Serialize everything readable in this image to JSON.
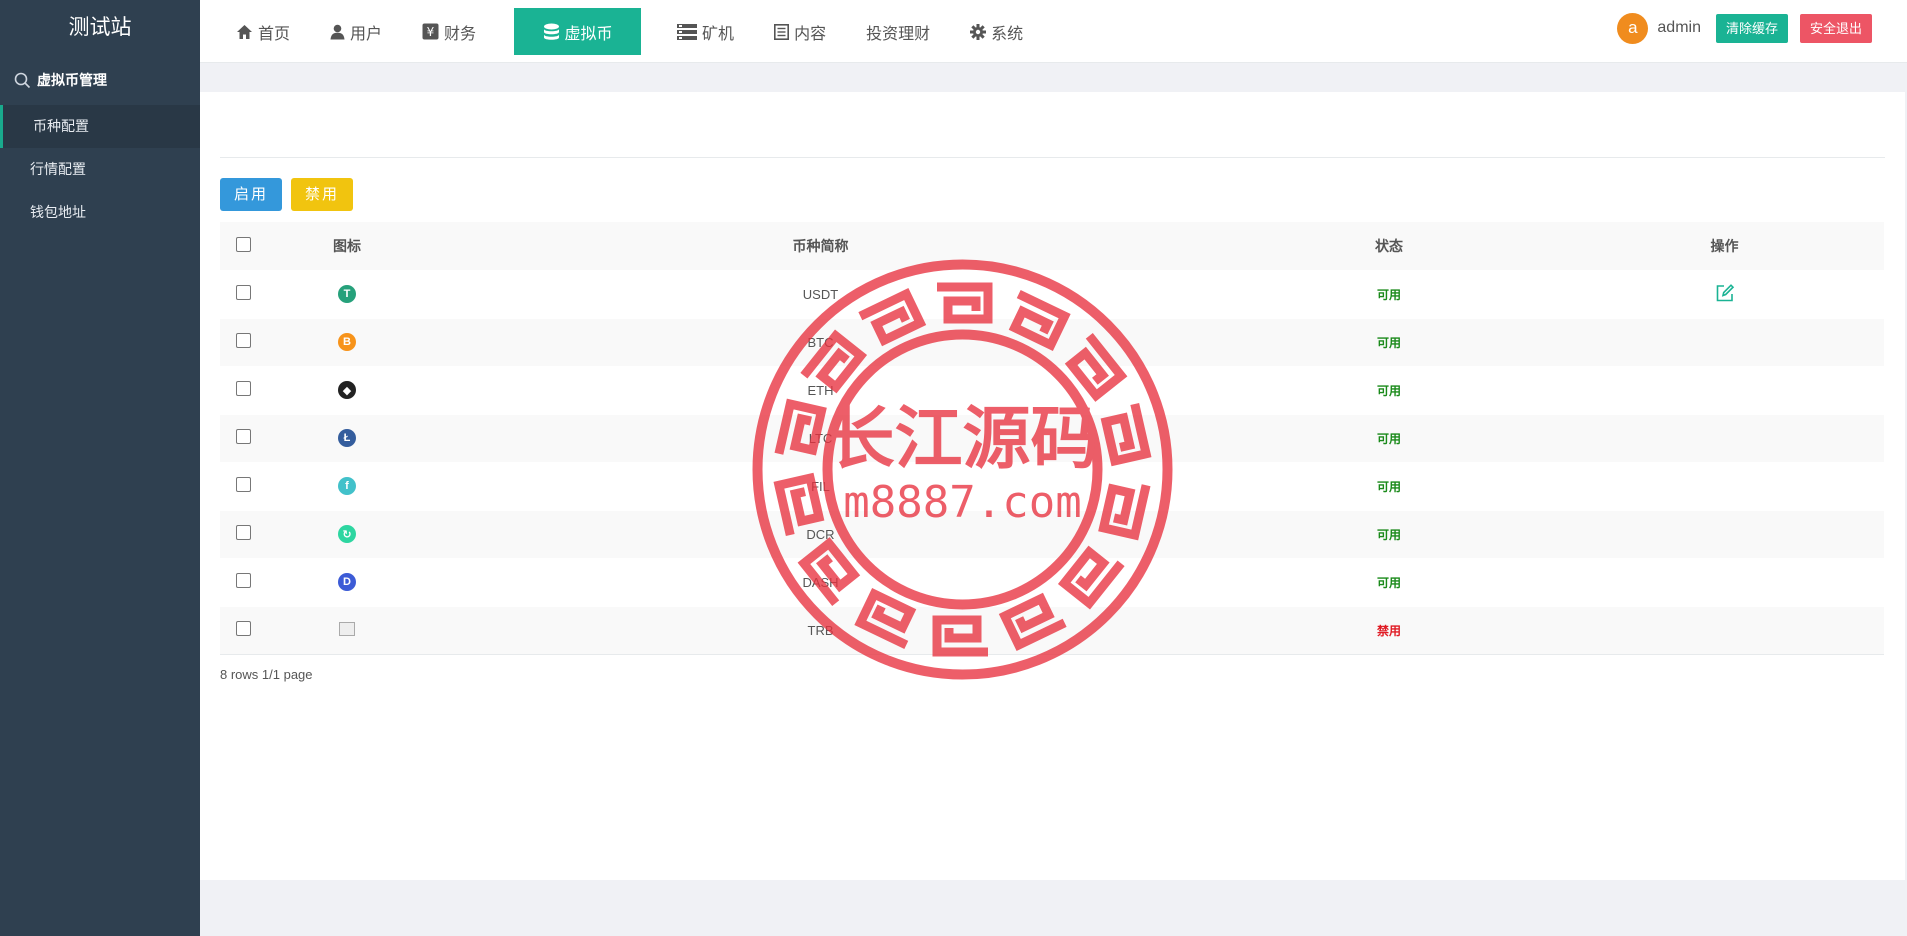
{
  "sidebar": {
    "site_title": "测试站",
    "section": "虚拟币管理",
    "items": [
      {
        "label": "币种配置",
        "active": true
      },
      {
        "label": "行情配置",
        "active": false
      },
      {
        "label": "钱包地址",
        "active": false
      }
    ]
  },
  "nav": {
    "items": [
      {
        "label": "首页",
        "icon": "home-icon"
      },
      {
        "label": "用户",
        "icon": "user-icon"
      },
      {
        "label": "财务",
        "icon": "yen-icon"
      },
      {
        "label": "虚拟币",
        "icon": "database-icon",
        "active": true
      },
      {
        "label": "矿机",
        "icon": "server-icon"
      },
      {
        "label": "内容",
        "icon": "document-icon"
      },
      {
        "label": "投资理财",
        "icon": ""
      },
      {
        "label": "系统",
        "icon": "gear-icon"
      }
    ]
  },
  "user": {
    "avatar_letter": "a",
    "name": "admin",
    "clear_cache": "清除缓存",
    "logout": "安全退出"
  },
  "toolbar": {
    "enable": "启用",
    "disable": "禁用"
  },
  "table": {
    "headers": {
      "icon": "图标",
      "name": "币种简称",
      "status": "状态",
      "action": "操作"
    },
    "rows": [
      {
        "name": "USDT",
        "status": "可用",
        "enabled": true,
        "icon_color": "#26a17b",
        "icon_glyph": "T"
      },
      {
        "name": "BTC",
        "status": "可用",
        "enabled": true,
        "icon_color": "#f7931a",
        "icon_glyph": "B"
      },
      {
        "name": "ETH",
        "status": "可用",
        "enabled": true,
        "icon_color": "#222222",
        "icon_glyph": "◆"
      },
      {
        "name": "LTC",
        "status": "可用",
        "enabled": true,
        "icon_color": "#345d9d",
        "icon_glyph": "Ł"
      },
      {
        "name": "FIL",
        "status": "可用",
        "enabled": true,
        "icon_color": "#42c1ca",
        "icon_glyph": "f"
      },
      {
        "name": "DCR",
        "status": "可用",
        "enabled": true,
        "icon_color": "#2ed6a1",
        "icon_glyph": "↻"
      },
      {
        "name": "DASH",
        "status": "可用",
        "enabled": true,
        "icon_color": "#3c5bd6",
        "icon_glyph": "D"
      },
      {
        "name": "TRB",
        "status": "禁用",
        "enabled": false,
        "icon_color": "",
        "icon_glyph": ""
      }
    ]
  },
  "pager": "8 rows 1/1 page",
  "watermark": {
    "title": "长江源码",
    "url": "m8887.com",
    "color": "#e8323f"
  },
  "colors": {
    "sidebar_bg": "#2f4050",
    "accent": "#1ab394",
    "danger": "#ed5565",
    "primary": "#3498db",
    "warning": "#f1c40f"
  }
}
